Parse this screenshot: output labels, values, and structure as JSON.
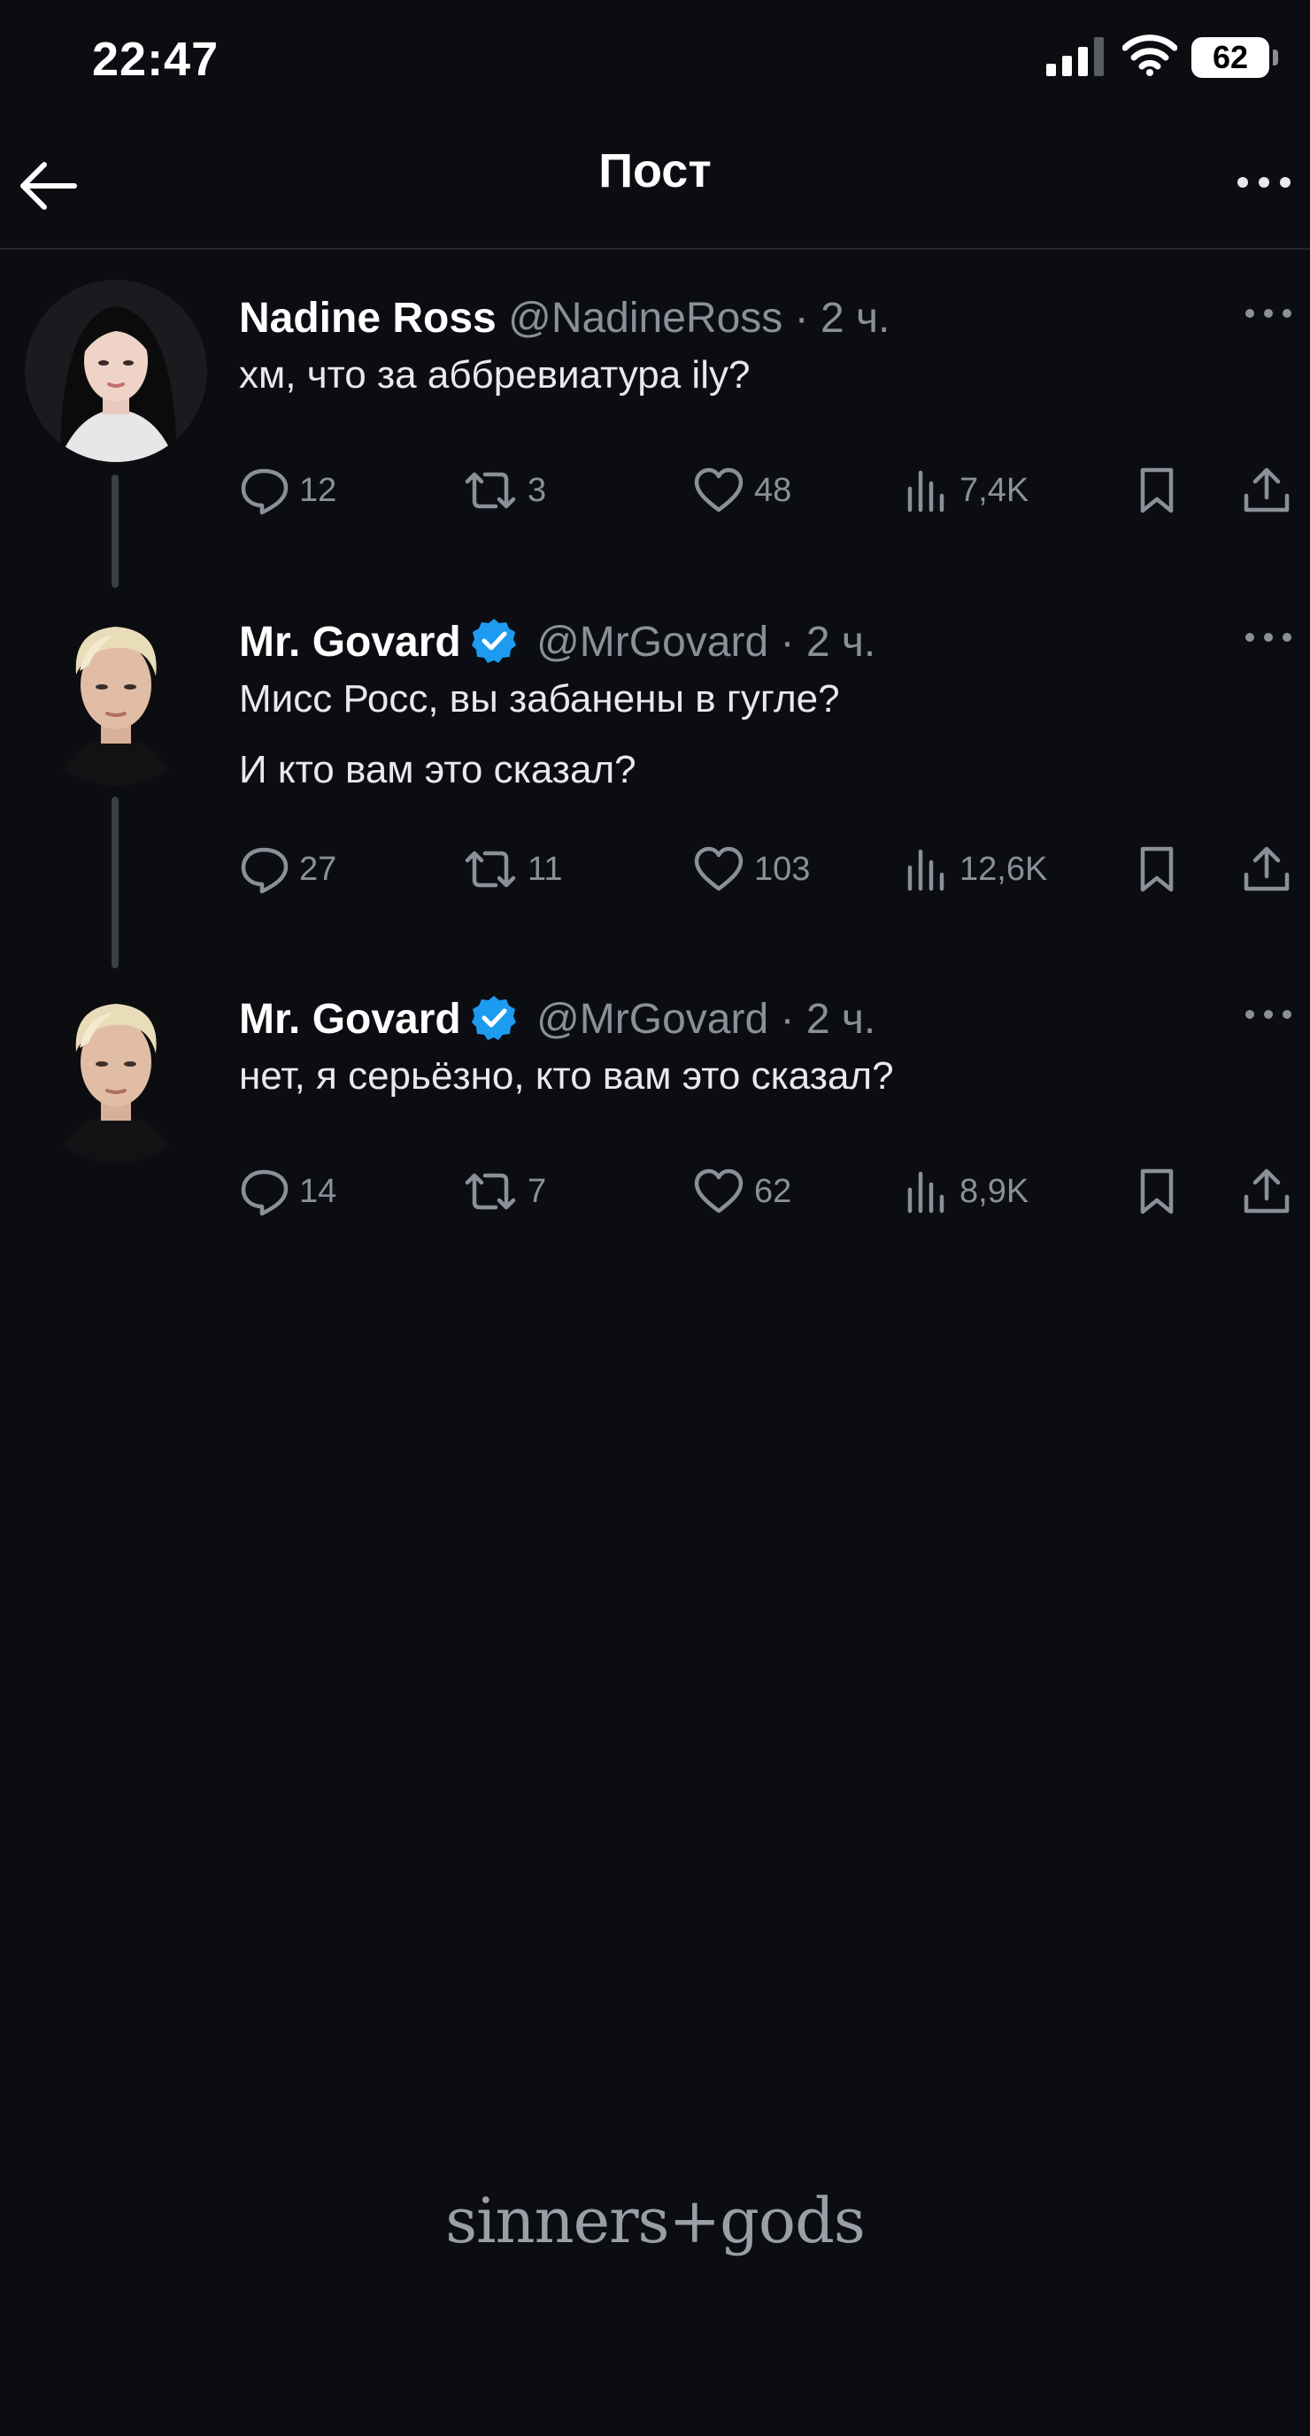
{
  "status_bar": {
    "time": "22:47",
    "battery": "62",
    "icons": [
      "signal-icon",
      "wifi-icon",
      "battery-icon"
    ]
  },
  "header": {
    "title": "Пост",
    "icons": [
      "arrow-left-icon",
      "more-horizontal-icon"
    ]
  },
  "posts": [
    {
      "author": "Nadine Ross",
      "handle": "@NadineRoss",
      "separator": "·",
      "time": "2 ч.",
      "verified": false,
      "lines": [
        "хм, что за аббревиатура ily?"
      ],
      "replies": "12",
      "reposts": "3",
      "likes": "48",
      "views": "7,4K"
    },
    {
      "author": "Mr. Govard",
      "handle": "@MrGovard",
      "separator": "·",
      "time": "2 ч.",
      "verified": true,
      "lines": [
        "Мисс Росс, вы забанены в гугле?",
        "И кто вам это сказал?"
      ],
      "replies": "27",
      "reposts": "11",
      "likes": "103",
      "views": "12,6K"
    },
    {
      "author": "Mr. Govard",
      "handle": "@MrGovard",
      "separator": "·",
      "time": "2 ч.",
      "verified": true,
      "lines": [
        "нет, я серьёзно, кто вам это сказал?"
      ],
      "replies": "14",
      "reposts": "7",
      "likes": "62",
      "views": "8,9K"
    }
  ],
  "action_icons": [
    "reply-icon",
    "repost-icon",
    "heart-icon",
    "views-icon",
    "bookmark-icon",
    "share-icon"
  ],
  "colors": {
    "background": "#0b0d12",
    "text": "#e7e9ea",
    "muted": "#8b9098",
    "verified": "#1d9bf0"
  },
  "watermark": "sinners+gods"
}
